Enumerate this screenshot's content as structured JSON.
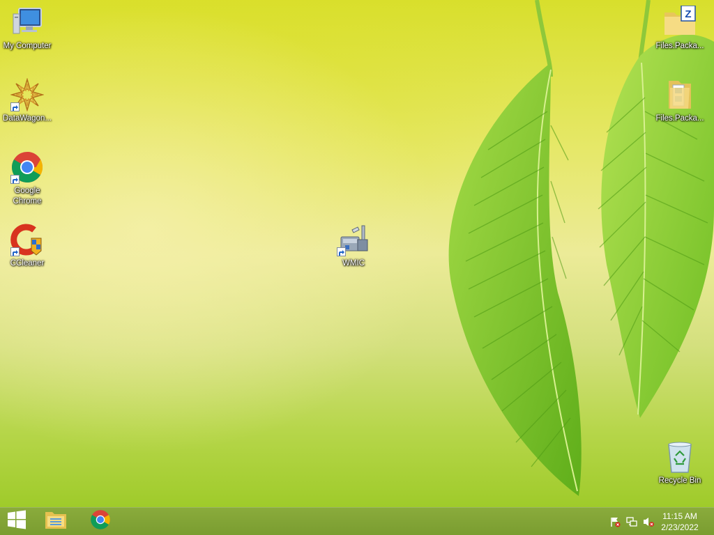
{
  "desktop": {
    "icons": [
      {
        "label": "My Computer",
        "icon": "computer-icon"
      },
      {
        "label": "DataWagon...",
        "icon": "datawagon-icon"
      },
      {
        "label": "Google Chrome",
        "icon": "chrome-icon"
      },
      {
        "label": "CCleaner",
        "icon": "ccleaner-icon"
      },
      {
        "label": "WMIC",
        "icon": "wmic-icon"
      },
      {
        "label": "Files.Packa...",
        "icon": "zip-folder-icon"
      },
      {
        "label": "Files.Packa...",
        "icon": "folder-icon"
      },
      {
        "label": "Recycle Bin",
        "icon": "recycle-bin-icon"
      }
    ]
  },
  "taskbar": {
    "start_icon": "windows-start-icon",
    "pinned": [
      {
        "name": "File Explorer",
        "icon": "file-explorer-icon"
      },
      {
        "name": "Google Chrome",
        "icon": "chrome-icon"
      }
    ],
    "tray": [
      "action-center-flag-icon",
      "network-icon",
      "volume-muted-icon"
    ],
    "clock": {
      "time": "11:15 AM",
      "date": "2/23/2022"
    }
  },
  "colors": {
    "taskbar": "#7f a33a",
    "wallpaper_top": "#d8df2c",
    "wallpaper_bottom": "#9fcb2a",
    "leaf": "#7cc82a"
  }
}
